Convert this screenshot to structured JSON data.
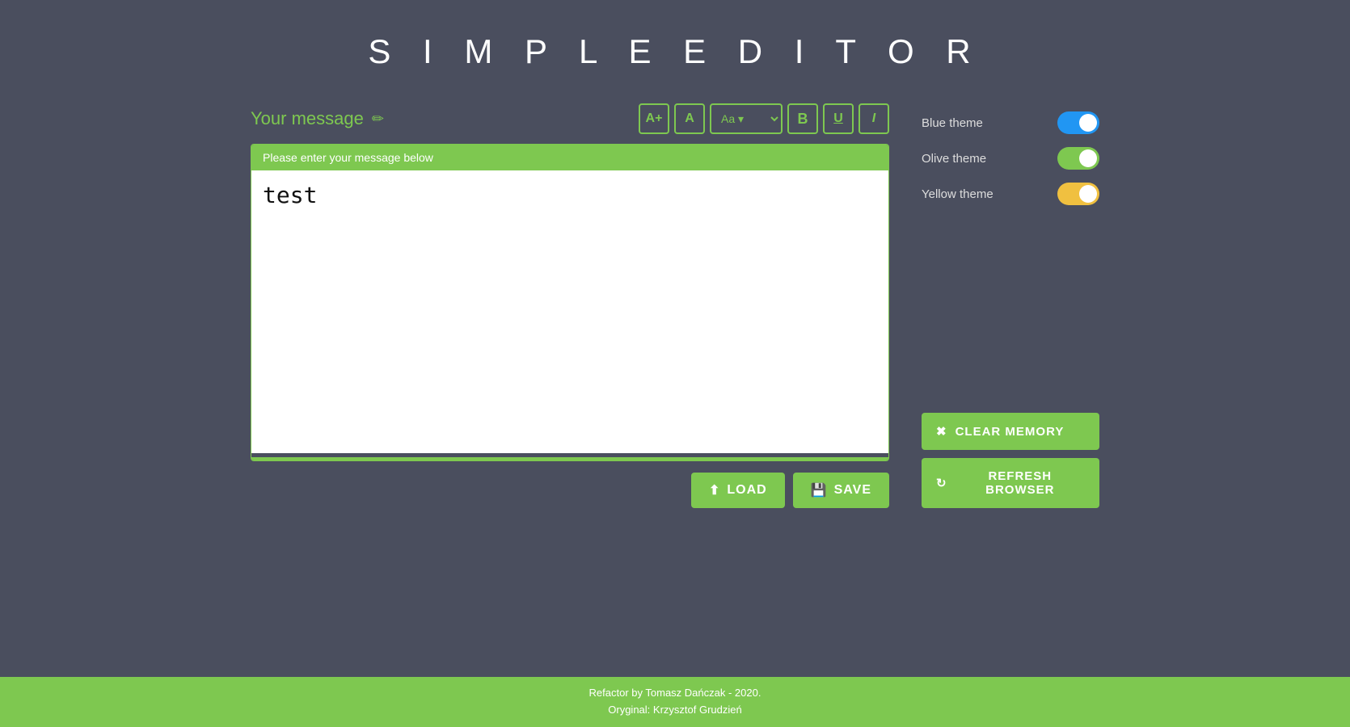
{
  "app": {
    "title": "S I M P L E   E D I T O R"
  },
  "editor": {
    "message_label": "Your message",
    "placeholder_bar": "Please enter your message below",
    "content": "test"
  },
  "toolbar": {
    "increase_font_label": "A+",
    "decrease_font_label": "A",
    "font_size_label": "Aa",
    "bold_label": "B",
    "underline_label": "U",
    "italic_label": "I"
  },
  "buttons": {
    "load_label": "LOAD",
    "save_label": "SAVE"
  },
  "sidebar": {
    "themes": [
      {
        "label": "Blue theme",
        "type": "blue",
        "checked": true
      },
      {
        "label": "Olive theme",
        "type": "olive",
        "checked": true
      },
      {
        "label": "Yellow theme",
        "type": "yellow",
        "checked": true
      }
    ],
    "clear_memory_label": "CLEAR MEMORY",
    "refresh_browser_label": "REFRESH BROWSER"
  },
  "footer": {
    "line1": "Refactor by Tomasz Dańczak - 2020.",
    "line2": "Oryginal: Krzysztof Grudzień"
  }
}
